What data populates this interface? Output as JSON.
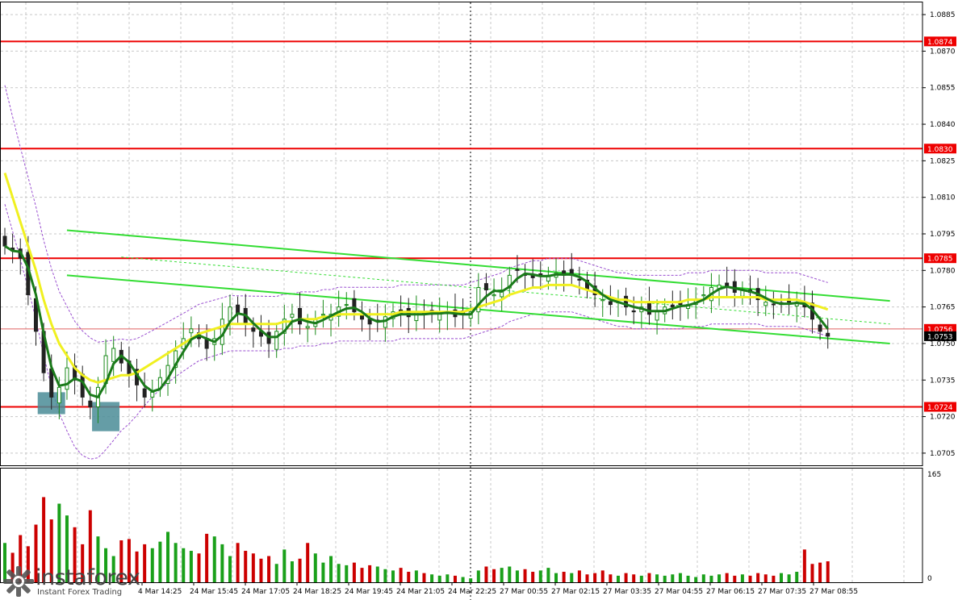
{
  "brand": {
    "name": "instaforex",
    "tagline": "Instant Forex Trading"
  },
  "colors": {
    "bull": "#1a8a1a",
    "bear": "#222222",
    "level": "#ee0000",
    "ma_fast": "#1a7a1a",
    "ma_slow": "#f0f020",
    "channel": "#33dd33",
    "bollinger": "#9a4fd0",
    "signal_box": "#4a8c96",
    "volume_up": "#1aa01a",
    "volume_down": "#cc0000"
  },
  "price_axis": {
    "ticks": [
      "1.0885",
      "1.0870",
      "1.0855",
      "1.0840",
      "1.0825",
      "1.0810",
      "1.0795",
      "1.0780",
      "1.0765",
      "1.0750",
      "1.0735",
      "1.0720",
      "1.0705"
    ],
    "current_price": "1.0753",
    "current_price_marker": "1.0756"
  },
  "volume_axis": {
    "max_label": "165",
    "zero_label": "0"
  },
  "time_axis": {
    "labels": [
      "4 Mar 14:25",
      "24 Mar 15:45",
      "24 Mar 17:05",
      "24 Mar 18:25",
      "24 Mar 19:45",
      "24 Mar 21:05",
      "24 Mar 22:25",
      "27 Mar 00:55",
      "27 Mar 02:15",
      "27 Mar 03:35",
      "27 Mar 04:55",
      "27 Mar 06:15",
      "27 Mar 07:35",
      "27 Mar 08:55"
    ]
  },
  "levels": [
    {
      "label": "1.0874",
      "price": 1.0874
    },
    {
      "label": "1.0830",
      "price": 1.083
    },
    {
      "label": "1.0785",
      "price": 1.0785
    },
    {
      "label": "1.0724",
      "price": 1.0724
    }
  ],
  "chart_data": {
    "type": "line",
    "title": "",
    "instrument_timeframe": "candlestick with volume",
    "ylim": [
      1.07,
      1.089
    ],
    "volume_ylim": [
      0,
      165
    ],
    "x_labels": [
      "4 Mar 14:25",
      "24 Mar 15:45",
      "24 Mar 17:05",
      "24 Mar 18:25",
      "24 Mar 19:45",
      "24 Mar 21:05",
      "24 Mar 22:25",
      "27 Mar 00:55",
      "27 Mar 02:15",
      "27 Mar 03:35",
      "27 Mar 04:55",
      "27 Mar 06:15",
      "27 Mar 07:35",
      "27 Mar 08:55"
    ],
    "series": [
      {
        "values": [
          1.079,
          1.0788,
          1.0785,
          1.077,
          1.0755,
          1.0738,
          1.0728,
          1.0732,
          1.074,
          1.0735,
          1.0728,
          1.0724,
          1.0732,
          1.0745,
          1.0748,
          1.0742,
          1.0737,
          1.0733,
          1.0728,
          1.073,
          1.0736,
          1.0741,
          1.0747,
          1.0752,
          1.0756,
          1.0752,
          1.0748,
          1.0752,
          1.076,
          1.0765,
          1.0762,
          1.0758,
          1.0755,
          1.0753,
          1.075,
          1.0755,
          1.076,
          1.0762,
          1.0758,
          1.0757,
          1.076,
          1.0762,
          1.0762,
          1.0765,
          1.0766,
          1.0763,
          1.076,
          1.0758,
          1.0759,
          1.0761,
          1.0763,
          1.0762,
          1.0761,
          1.0763,
          1.0762,
          1.0762,
          1.0763,
          1.0763,
          1.0761,
          1.0762,
          1.0763,
          1.0773,
          1.0772,
          1.077,
          1.0772,
          1.0778,
          1.078,
          1.0778,
          1.0777,
          1.0778,
          1.0778,
          1.0779,
          1.0778,
          1.0778,
          1.0776,
          1.0772,
          1.077,
          1.0768,
          1.0766,
          1.0767,
          1.0765,
          1.0763,
          1.0765,
          1.0762,
          1.0763,
          1.0765,
          1.0765,
          1.0766,
          1.0766,
          1.0768,
          1.077,
          1.0773,
          1.0774,
          1.0773,
          1.0771,
          1.0772,
          1.0771,
          1.0768,
          1.0767,
          1.0766,
          1.0766,
          1.0767,
          1.0767,
          1.0765,
          1.076,
          1.0755,
          1.0753
        ]
      },
      {
        "values": [
          1.082,
          1.081,
          1.08,
          1.079,
          1.078,
          1.0768,
          1.0758,
          1.075,
          1.0745,
          1.074,
          1.0737,
          1.0735,
          1.0734,
          1.0735,
          1.0736,
          1.0737,
          1.0737,
          1.0738,
          1.074,
          1.0742,
          1.0744,
          1.0746,
          1.0748,
          1.075,
          1.0752,
          1.0754,
          1.0755,
          1.0756,
          1.0757,
          1.0758,
          1.0758,
          1.0758,
          1.0758,
          1.0758,
          1.0758,
          1.0758,
          1.0759,
          1.0759,
          1.076,
          1.076,
          1.076,
          1.0761,
          1.0761,
          1.0762,
          1.0762,
          1.0762,
          1.0762,
          1.0762,
          1.0762,
          1.0762,
          1.0762,
          1.0763,
          1.0763,
          1.0763,
          1.0763,
          1.0763,
          1.0763,
          1.0763,
          1.0763,
          1.0763,
          1.0764,
          1.0765,
          1.0766,
          1.0767,
          1.0768,
          1.077,
          1.0771,
          1.0772,
          1.0773,
          1.0773,
          1.0774,
          1.0774,
          1.0774,
          1.0774,
          1.0773,
          1.0772,
          1.0771,
          1.077,
          1.0769,
          1.0768,
          1.0768,
          1.0767,
          1.0767,
          1.0767,
          1.0767,
          1.0767,
          1.0767,
          1.0767,
          1.0768,
          1.0768,
          1.0768,
          1.0769,
          1.0769,
          1.0769,
          1.0769,
          1.0769,
          1.0769,
          1.0769,
          1.0768,
          1.0768,
          1.0768,
          1.0768,
          1.0768,
          1.0767,
          1.0766,
          1.0765,
          1.0764
        ]
      }
    ],
    "volume": [
      60,
      45,
      72,
      55,
      88,
      130,
      96,
      120,
      102,
      84,
      58,
      110,
      70,
      52,
      40,
      64,
      66,
      47,
      58,
      52,
      62,
      77,
      60,
      52,
      48,
      44,
      74,
      70,
      58,
      40,
      60,
      48,
      44,
      36,
      40,
      28,
      50,
      32,
      36,
      60,
      44,
      30,
      40,
      28,
      26,
      30,
      22,
      26,
      24,
      20,
      18,
      22,
      16,
      18,
      14,
      12,
      10,
      12,
      10,
      8,
      6,
      18,
      24,
      20,
      22,
      24,
      18,
      20,
      16,
      18,
      22,
      14,
      16,
      14,
      18,
      12,
      14,
      18,
      12,
      10,
      14,
      12,
      10,
      14,
      12,
      10,
      12,
      14,
      10,
      8,
      12,
      10,
      12,
      14,
      10,
      12,
      10,
      14,
      12,
      10,
      14,
      12,
      16,
      50,
      28,
      30,
      32
    ],
    "channel_upper": {
      "from": {
        "i": 8,
        "y": 1.07965
      },
      "to": {
        "i": 114,
        "y": 1.07675
      }
    },
    "channel_lower": {
      "from": {
        "i": 8,
        "y": 1.0778
      },
      "to": {
        "i": 114,
        "y": 1.075
      }
    },
    "channel_mid_dashed": {
      "from": {
        "i": 15,
        "y": 1.07855
      },
      "to": {
        "i": 114,
        "y": 1.0758
      }
    },
    "signal_boxes": [
      {
        "i": 6,
        "price_top": 1.073,
        "price_bottom": 1.0721
      },
      {
        "i": 13,
        "price_top": 1.0726,
        "price_bottom": 1.0714
      }
    ]
  }
}
